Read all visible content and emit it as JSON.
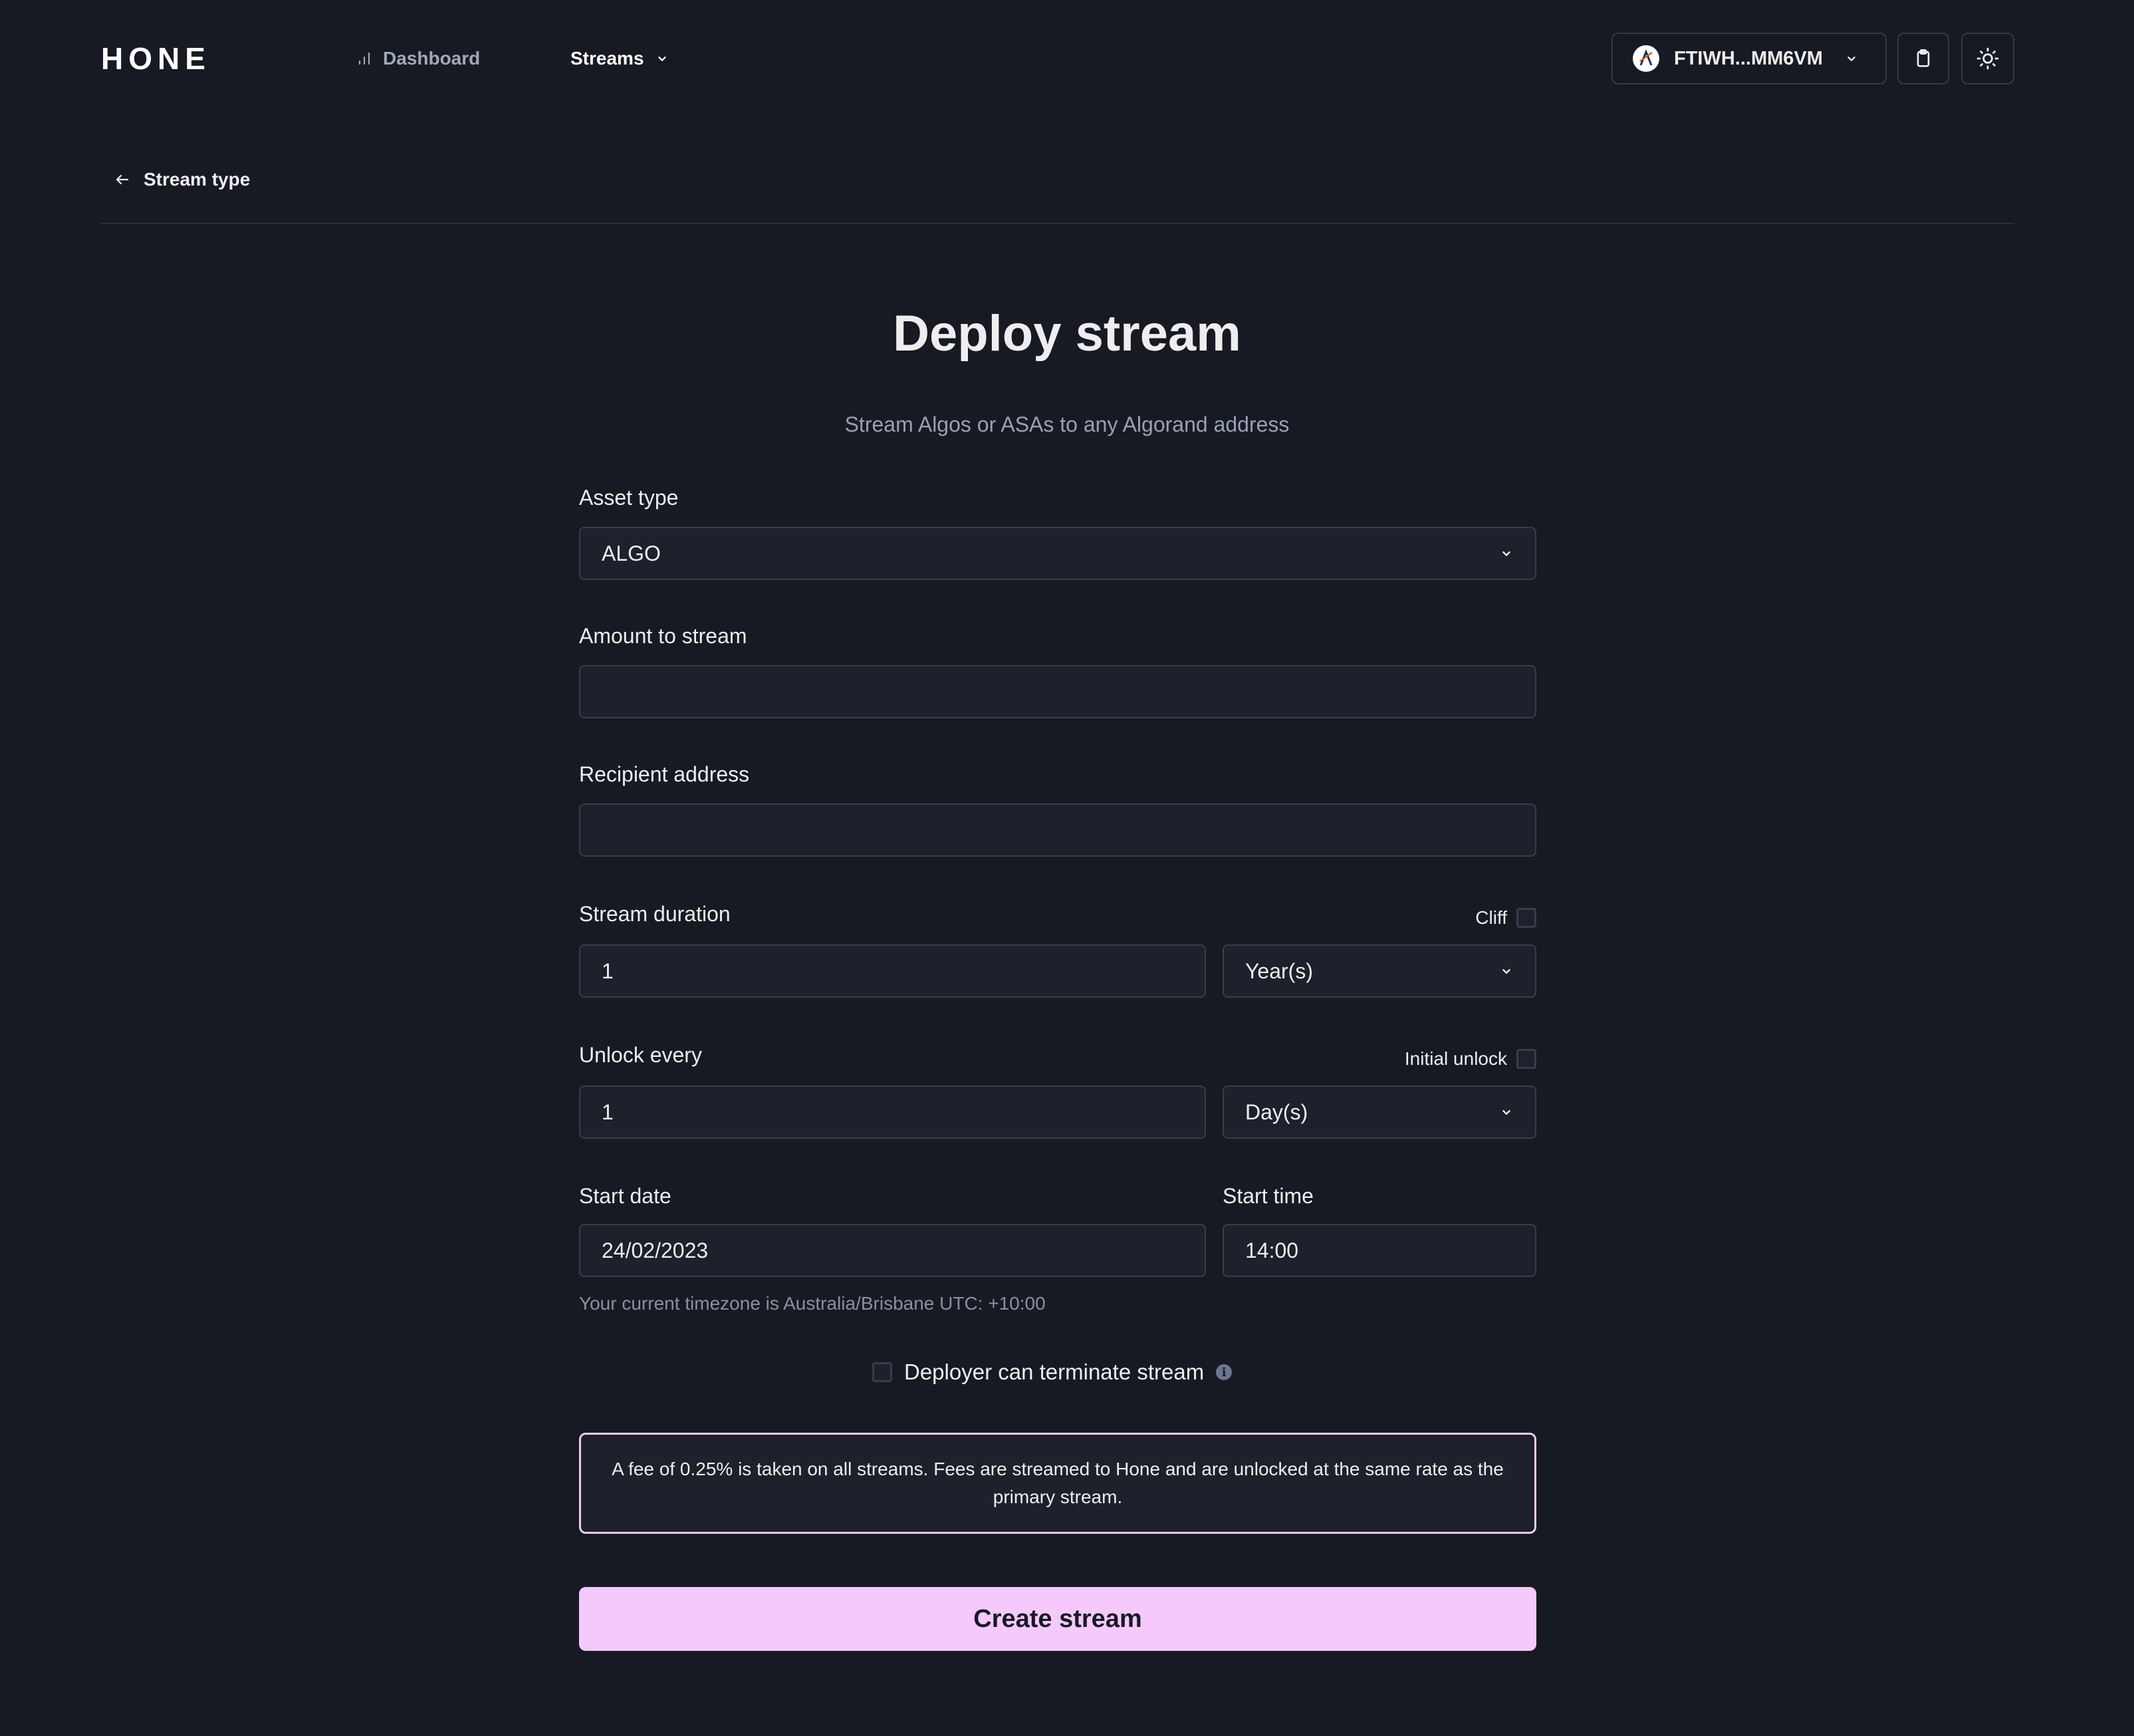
{
  "header": {
    "logo": "HONE",
    "nav": {
      "dashboard": "Dashboard",
      "streams": "Streams"
    },
    "wallet": {
      "address": "FTIWH...MM6VM",
      "avatar_icon": "algorand-logo-icon"
    },
    "icons": {
      "clipboard": "clipboard-icon",
      "theme": "sun-icon"
    }
  },
  "back_link": "Stream type",
  "page": {
    "title": "Deploy stream",
    "subtitle": "Stream Algos or ASAs to any Algorand address"
  },
  "form": {
    "asset_type": {
      "label": "Asset type",
      "value": "ALGO"
    },
    "amount": {
      "label": "Amount to stream",
      "value": ""
    },
    "recipient": {
      "label": "Recipient address",
      "value": ""
    },
    "duration": {
      "label": "Stream duration",
      "value": "1",
      "unit": "Year(s)",
      "cliff_label": "Cliff",
      "cliff_checked": false
    },
    "unlock": {
      "label": "Unlock every",
      "value": "1",
      "unit": "Day(s)",
      "initial_unlock_label": "Initial unlock",
      "initial_unlock_checked": false
    },
    "start_date": {
      "label": "Start date",
      "value": "24/02/2023"
    },
    "start_time": {
      "label": "Start time",
      "value": "14:00"
    },
    "timezone_note": "Your current timezone is Australia/Brisbane UTC: +10:00",
    "terminate": {
      "label": "Deployer can terminate stream",
      "checked": false
    },
    "fee_notice": "A fee of 0.25% is taken on all streams. Fees are streamed to Hone and are unlocked at the same rate as the primary stream.",
    "submit_label": "Create stream"
  },
  "colors": {
    "background": "#181a23",
    "field_bg": "#1e212b",
    "accent": "#f5c9fb",
    "muted_text": "#98a1b4"
  }
}
